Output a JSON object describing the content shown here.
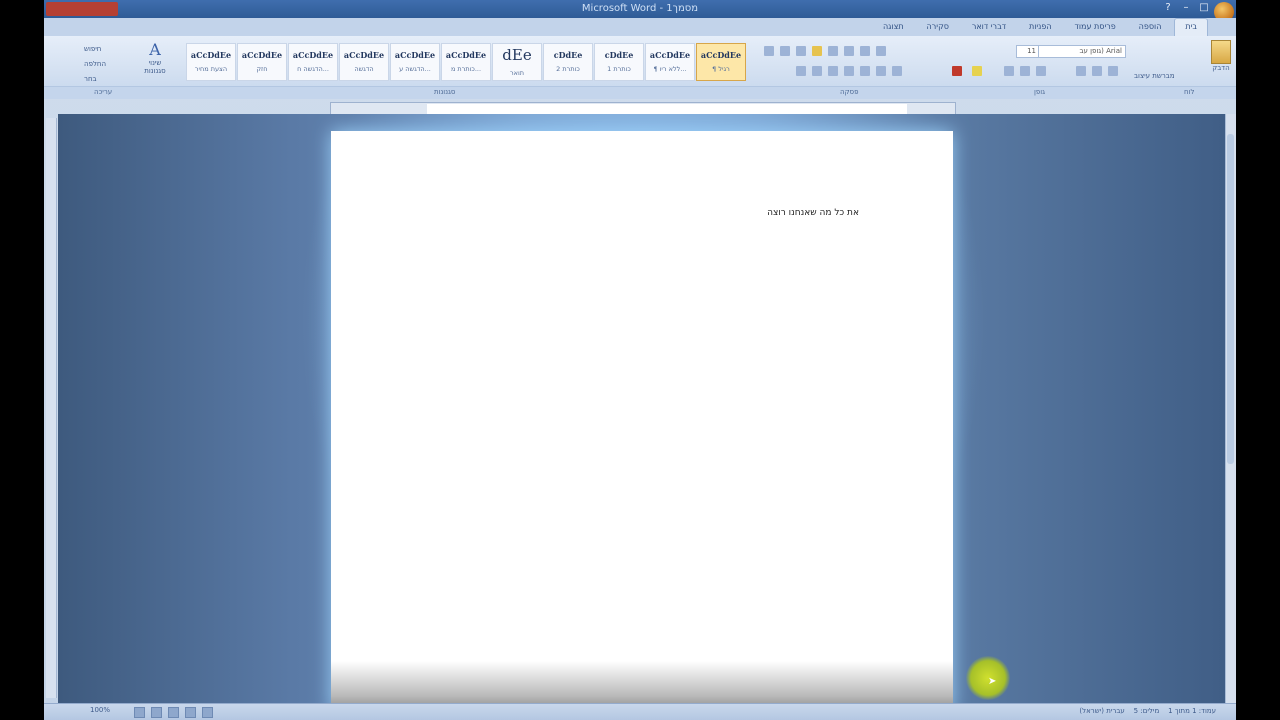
{
  "window": {
    "title": "Microsoft Word - מסמך1"
  },
  "ribbon_tabs": [
    "בית",
    "הוספה",
    "פריסת עמוד",
    "הפניות",
    "דברי דואר",
    "סקירה",
    "תצוגה"
  ],
  "ribbon": {
    "font_name": "Arial (גופן עב",
    "font_size": "11",
    "styles": [
      {
        "sample": "aCcDdEe",
        "name": "¶ רגיל",
        "selected": true
      },
      {
        "sample": "aCcDdEe",
        "name": "¶ ללא ריו..."
      },
      {
        "sample": "cDdEe",
        "name": "כותרת 1"
      },
      {
        "sample": "cDdEe",
        "name": "כותרת 2"
      },
      {
        "sample": "dEe",
        "name": "תואר"
      },
      {
        "sample": "aCcDdEe",
        "name": "כותרת מ..."
      },
      {
        "sample": "aCcDdEe",
        "name": "הדגשה ע..."
      },
      {
        "sample": "aCcDdEe",
        "name": "הדגשה"
      },
      {
        "sample": "aCcDdEe",
        "name": "הדגשה ח..."
      },
      {
        "sample": "aCcDdEe",
        "name": "חזק"
      },
      {
        "sample": "aCcDdEe",
        "name": "הצעת מחיר"
      }
    ],
    "change_styles_label": "שינוי סגנונות",
    "editing": [
      "חיפוש",
      "החלפה",
      "בחר"
    ],
    "clipboard_label": "הדבק",
    "format_painter_label": "מברשת עיצוב",
    "group_labels": {
      "clipboard": "לוח",
      "font": "גופן",
      "paragraph": "פסקה",
      "styles": "סגנונות",
      "editing": "עריכה"
    }
  },
  "document": {
    "body_text": "את כל מה שאנחנו רוצה"
  },
  "statusbar": {
    "page_info": "עמוד: 1 מתוך 1",
    "words": "מילים: 5",
    "language": "עברית (ישראל)",
    "zoom": "100%"
  },
  "colors": {
    "titlebar": "#2f5b96",
    "ribbon": "#d3e0f1",
    "workspace": "#5a7aa6",
    "selected_style": "#fde7a8"
  }
}
